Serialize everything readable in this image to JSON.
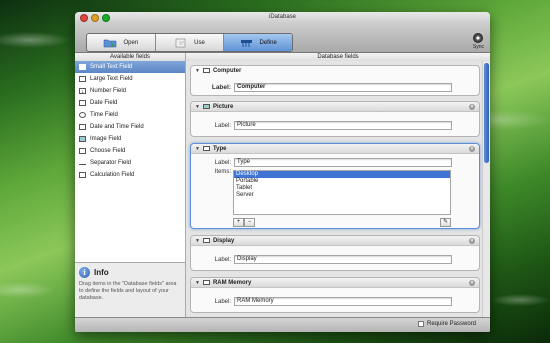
{
  "window": {
    "title": "iDatabase"
  },
  "toolbar": {
    "segments": [
      {
        "label": "Open",
        "icon": "folder-icon"
      },
      {
        "label": "Use",
        "icon": "hand-icon"
      },
      {
        "label": "Define",
        "icon": "tools-icon"
      }
    ],
    "sync_label": "Sync"
  },
  "headers": {
    "left": "Available fields",
    "right": "Database fields"
  },
  "sidebar": {
    "items": [
      {
        "label": "Small Text Field",
        "icon": "small-text-icon"
      },
      {
        "label": "Large Text Field",
        "icon": "large-text-icon"
      },
      {
        "label": "Number Field",
        "icon": "number-icon"
      },
      {
        "label": "Date Field",
        "icon": "date-icon"
      },
      {
        "label": "Time Field",
        "icon": "time-icon"
      },
      {
        "label": "Date and Time Field",
        "icon": "datetime-icon"
      },
      {
        "label": "Image Field",
        "icon": "image-icon"
      },
      {
        "label": "Choose Field",
        "icon": "choose-icon"
      },
      {
        "label": "Separator Field",
        "icon": "separator-icon"
      },
      {
        "label": "Calculation Field",
        "icon": "calculation-icon"
      }
    ]
  },
  "info": {
    "title": "Info",
    "text": "Drag items in the \"Database fields\" area to define the fields and layout of your database."
  },
  "fields": [
    {
      "name": "Computer",
      "label_caption": "Label:",
      "label_value": "Computer"
    },
    {
      "name": "Picture",
      "label_caption": "Label:",
      "label_value": "Picture"
    },
    {
      "name": "Type",
      "label_caption": "Label:",
      "label_value": "Type",
      "items_caption": "Items:",
      "items": [
        "Desktop",
        "Portable",
        "Tablet",
        "Server"
      ]
    },
    {
      "name": "Display",
      "label_caption": "Label:",
      "label_value": "Display"
    },
    {
      "name": "RAM Memory",
      "label_caption": "Label:",
      "label_value": "RAM Memory"
    }
  ],
  "footer": {
    "require_password": "Require Password"
  }
}
